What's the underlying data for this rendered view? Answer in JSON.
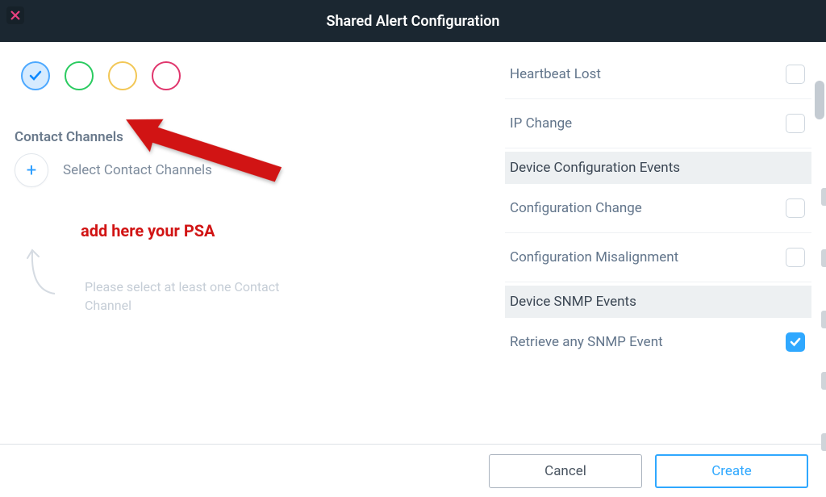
{
  "modal": {
    "title": "Shared Alert Configuration"
  },
  "left": {
    "colors": [
      "blue-selected",
      "green",
      "yellow",
      "pink"
    ],
    "contact_section_label": "Contact Channels",
    "add_channel_label": "Select Contact Channels",
    "hint_text": "Please select at least one Contact Channel"
  },
  "annotations": {
    "add_psa": "add here your PSA"
  },
  "events": {
    "heartbeat_lost": "Heartbeat Lost",
    "ip_change": "IP Change",
    "hdr_device_config": "Device Configuration Events",
    "config_change": "Configuration Change",
    "config_misalign": "Configuration Misalignment",
    "hdr_snmp": "Device SNMP Events",
    "retrieve_snmp": "Retrieve any SNMP Event"
  },
  "footer": {
    "cancel": "Cancel",
    "create": "Create"
  }
}
